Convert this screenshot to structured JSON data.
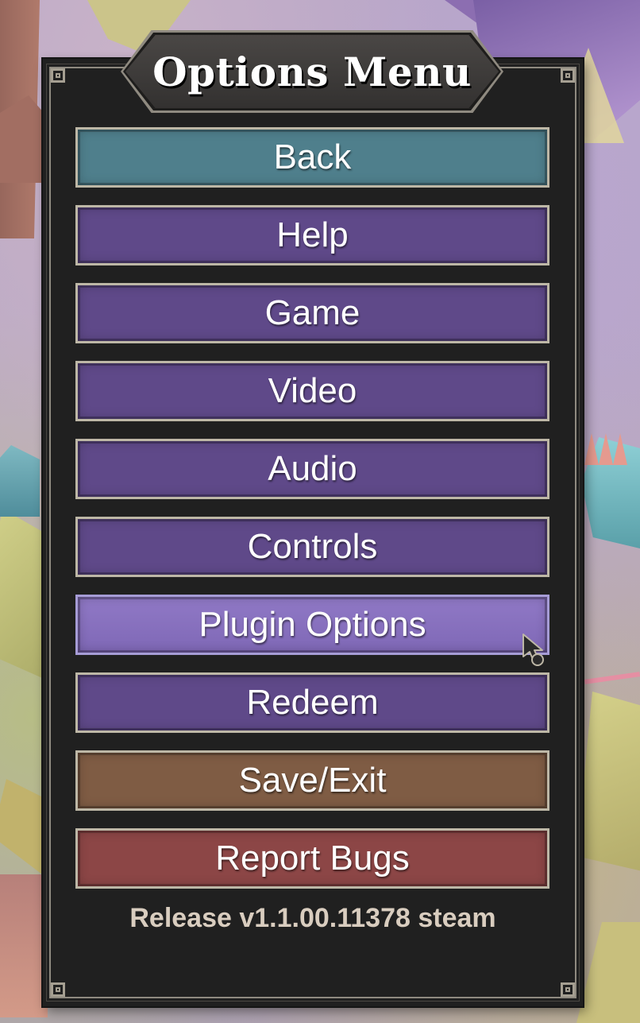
{
  "title": "Options Menu",
  "colors": {
    "panel": "#202020",
    "border": "#bdb7a6",
    "back": "#4f7f8c",
    "default": "#5f4989",
    "hover": "#8a73c2",
    "save_exit": "#7f5c44",
    "report_bugs": "#8c4646",
    "version_text": "#d9cdbf"
  },
  "buttons": [
    {
      "label": "Back",
      "style": "teal"
    },
    {
      "label": "Help",
      "style": "purple"
    },
    {
      "label": "Game",
      "style": "purple"
    },
    {
      "label": "Video",
      "style": "purple"
    },
    {
      "label": "Audio",
      "style": "purple"
    },
    {
      "label": "Controls",
      "style": "purple"
    },
    {
      "label": "Plugin Options",
      "style": "active"
    },
    {
      "label": "Redeem",
      "style": "purple"
    },
    {
      "label": "Save/Exit",
      "style": "brown"
    },
    {
      "label": "Report Bugs",
      "style": "red"
    }
  ],
  "version": "Release v1.1.00.11378 steam",
  "cursor_icon": "pointer-cursor-icon"
}
